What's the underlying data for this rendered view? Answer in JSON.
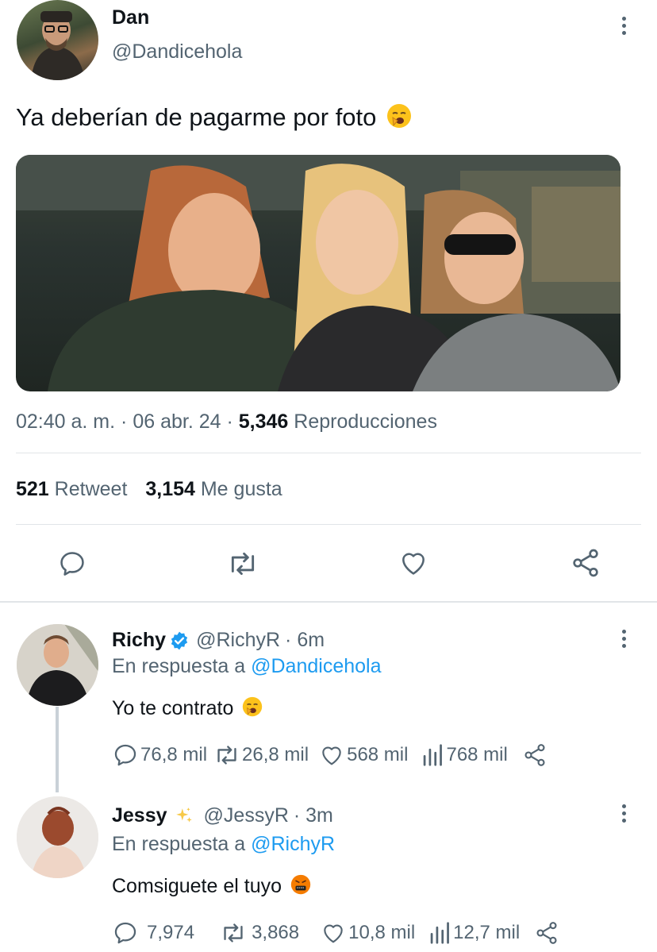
{
  "tweet": {
    "author_name": "Dan",
    "author_handle": "@Dandicehola",
    "text": "Ya deberían de pagarme por foto",
    "time": "02:40 a. m.",
    "date": "06 abr. 24",
    "sep": "·",
    "views_count": "5,346",
    "views_label": "Reproducciones",
    "retweets_count": "521",
    "retweets_label": "Retweet",
    "likes_count": "3,154",
    "likes_label": "Me gusta"
  },
  "replies": [
    {
      "name": "Richy",
      "handle": "@RichyR",
      "time": "· 6m",
      "reply_to_label": "En respuesta a",
      "reply_to_handle": "@Dandicehola",
      "text": "Yo te contrato",
      "comments": "76,8 mil",
      "retweets": "26,8 mil",
      "likes": "568 mil",
      "views": "768 mil"
    },
    {
      "name": "Jessy",
      "handle": "@JessyR",
      "time": "· 3m",
      "reply_to_label": "En respuesta a",
      "reply_to_handle": "@RichyR",
      "text": "Comsiguete el tuyo",
      "comments": "7,974",
      "retweets": "3,868",
      "likes": "10,8 mil",
      "views": "12,7 mil"
    }
  ],
  "icons": {
    "reply": "reply-icon",
    "retweet": "retweet-icon",
    "like": "heart-icon",
    "share": "share-icon",
    "views": "views-icon",
    "verified": "verified-badge-icon",
    "sparkles": "sparkles-icon",
    "more": "more-options-icon"
  },
  "colors": {
    "accent": "#1d9bf0",
    "secondary_text": "#536471",
    "primary_text": "#0f1419",
    "divider": "#e1e5e8"
  }
}
